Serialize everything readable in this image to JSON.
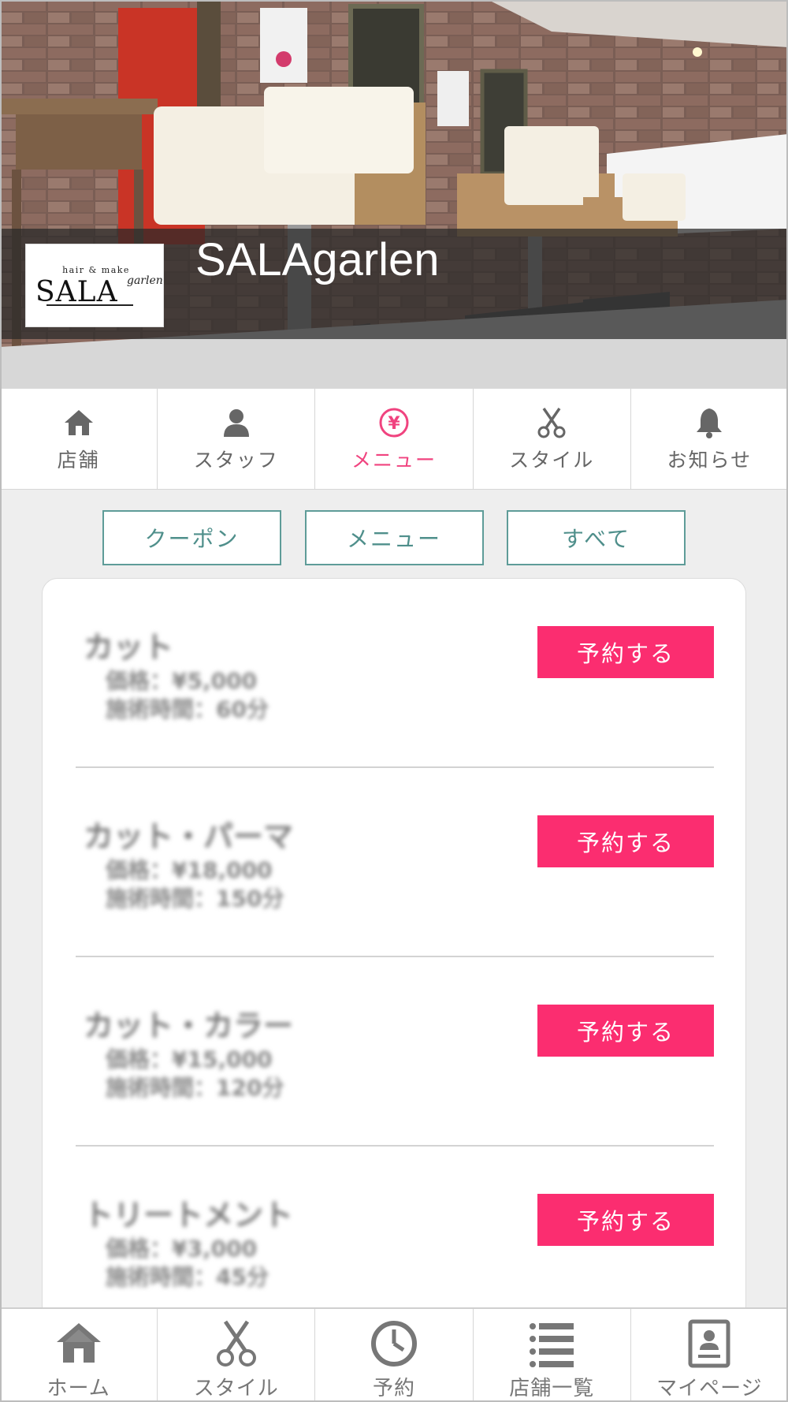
{
  "header": {
    "salon_name": "SALAgarlen",
    "logo": {
      "sub": "hair & make",
      "main": "SALA",
      "script": "garlen"
    }
  },
  "top_tabs": [
    {
      "label": "店舗",
      "icon": "home-icon",
      "active": false
    },
    {
      "label": "スタッフ",
      "icon": "person-icon",
      "active": false
    },
    {
      "label": "メニュー",
      "icon": "yen-icon",
      "active": true
    },
    {
      "label": "スタイル",
      "icon": "scissors-icon",
      "active": false
    },
    {
      "label": "お知らせ",
      "icon": "bell-icon",
      "active": false
    }
  ],
  "filters": [
    {
      "label": "クーポン"
    },
    {
      "label": "メニュー"
    },
    {
      "label": "すべて"
    }
  ],
  "menu_items": [
    {
      "name": "カット",
      "price": "価格：¥5,000",
      "time": "施術時間：60分",
      "button": "予約する"
    },
    {
      "name": "カット・パーマ",
      "price": "価格：¥18,000",
      "time": "施術時間：150分",
      "button": "予約する"
    },
    {
      "name": "カット・カラー",
      "price": "価格：¥15,000",
      "time": "施術時間：120分",
      "button": "予約する"
    },
    {
      "name": "トリートメント",
      "price": "価格：¥3,000",
      "time": "施術時間：45分",
      "button": "予約する"
    }
  ],
  "bottom_nav": [
    {
      "label": "ホーム",
      "icon": "home-icon"
    },
    {
      "label": "スタイル",
      "icon": "scissors-icon"
    },
    {
      "label": "予約",
      "icon": "clock-icon"
    },
    {
      "label": "店舗一覧",
      "icon": "list-icon"
    },
    {
      "label": "マイページ",
      "icon": "profile-icon"
    }
  ],
  "colors": {
    "accent_pink": "#fb2d70",
    "active_tab": "#f0437f",
    "filter_teal": "#5e9c98",
    "background": "#eeeeee"
  }
}
